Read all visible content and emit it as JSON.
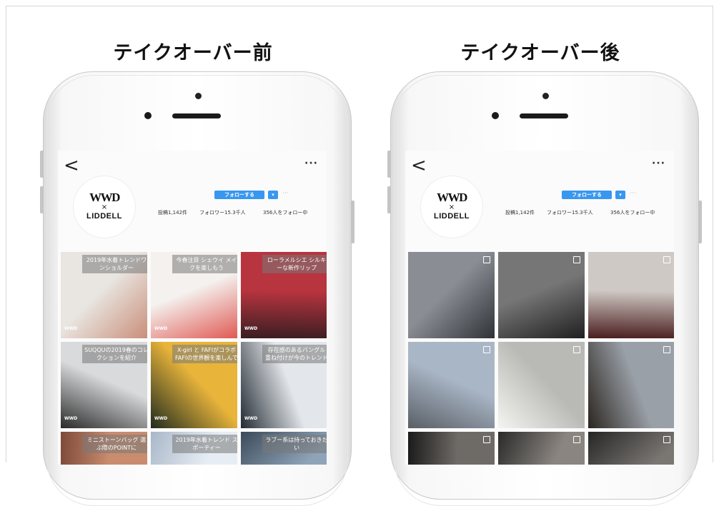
{
  "headings": {
    "before": "テイクオーバー前",
    "after": "テイクオーバー後"
  },
  "profile": {
    "logo_line1": "WWD",
    "logo_line2": "×",
    "logo_line3": "LIDDELL",
    "follow_label": "フォローする",
    "dropdown_label": "▾",
    "more_label": "···",
    "posts": "投稿1,142件",
    "followers": "フォロワー15.3千人",
    "following": "356人をフォロー中",
    "back_label": "<",
    "header_more": "···"
  },
  "before_tiles": [
    {
      "caption": "2019年水着トレンドワンショルダー",
      "colors": [
        "#e9e6e2",
        "#c98f7a"
      ]
    },
    {
      "caption": "今春注目 シェウイ メイクを楽しもう",
      "colors": [
        "#f4f1ee",
        "#e05a54"
      ]
    },
    {
      "caption": "ローラメルシエ シルキーな新作リップ",
      "colors": [
        "#b8343f",
        "#3a1e22"
      ]
    },
    {
      "caption": "SUQQUの2019春のコレクションを紹介",
      "colors": [
        "#d9dadc",
        "#2a2a2a"
      ]
    },
    {
      "caption": "X-girl と FAFIがコラボ FAFIの世界観を楽しんで",
      "colors": [
        "#e8b43a",
        "#1f2b1f"
      ]
    },
    {
      "caption": "存在感のあるバングル 重ね付けが今のトレンド",
      "colors": [
        "#e3e6ea",
        "#222a33"
      ]
    },
    {
      "caption": "ミニストーンバッグ 選ぶ際のPOINTに",
      "colors": [
        "#c98c6e",
        "#7e4a3a"
      ]
    },
    {
      "caption": "2019年水着トレンド スポーティー",
      "colors": [
        "#e7edf4",
        "#a8b7c8"
      ]
    },
    {
      "caption": "ラブー系は持っておきたい",
      "colors": [
        "#8fa4b8",
        "#3b4a5a"
      ]
    }
  ],
  "after_tiles": [
    {
      "colors": [
        "#8a8e94",
        "#2f3338"
      ]
    },
    {
      "colors": [
        "#767676",
        "#1f1f1f"
      ]
    },
    {
      "colors": [
        "#cfc9c5",
        "#4a1e1e"
      ]
    },
    {
      "colors": [
        "#a9b6c6",
        "#5a5f66"
      ]
    },
    {
      "colors": [
        "#b9b9b6",
        "#f4f4f1"
      ]
    },
    {
      "colors": [
        "#9aa0a8",
        "#2b2620"
      ]
    },
    {
      "colors": [
        "#6e6a66",
        "#1a1a1a"
      ]
    },
    {
      "colors": [
        "#8a8580",
        "#2a2a2a"
      ]
    },
    {
      "colors": [
        "#7a7672",
        "#262626"
      ]
    }
  ],
  "mini_logo": "WWD"
}
